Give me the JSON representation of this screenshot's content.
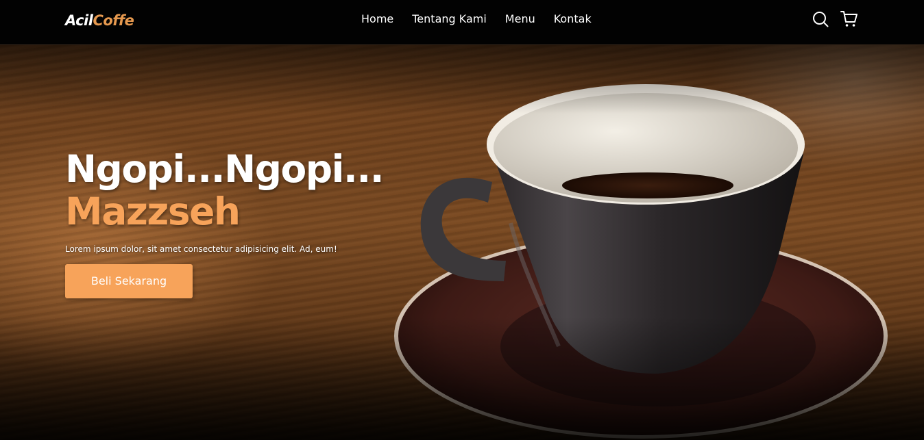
{
  "brand": {
    "part1": "Acil",
    "part2": "Coffe"
  },
  "nav": {
    "items": [
      {
        "label": "Home"
      },
      {
        "label": "Tentang Kami"
      },
      {
        "label": "Menu"
      },
      {
        "label": "Kontak"
      }
    ],
    "icons": [
      "search-icon",
      "shopping-cart-icon"
    ]
  },
  "hero": {
    "title_line1": "Ngopi...Ngopi...",
    "title_line2": "Mazzseh",
    "description": "Lorem ipsum dolor, sit amet consectetur adipisicing elit. Ad, eum!",
    "cta_label": "Beli Sekarang"
  },
  "colors": {
    "accent": "#f7a35a",
    "navbar_bg": "#020202",
    "text": "#ffffff"
  }
}
